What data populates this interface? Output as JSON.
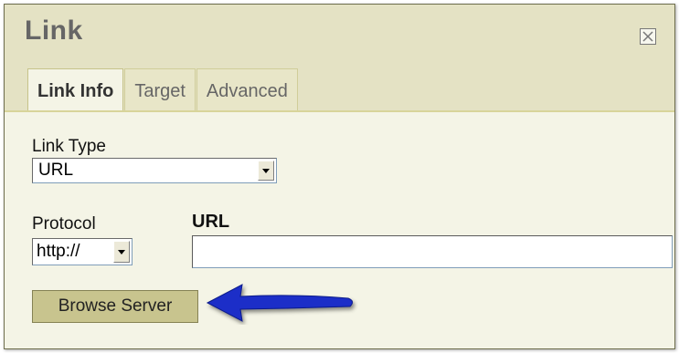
{
  "dialog": {
    "title": "Link",
    "close_icon": "close-icon"
  },
  "tabs": [
    {
      "label": "Link Info",
      "active": true
    },
    {
      "label": "Target",
      "active": false
    },
    {
      "label": "Advanced",
      "active": false
    }
  ],
  "form": {
    "link_type": {
      "label": "Link Type",
      "value": "URL"
    },
    "protocol": {
      "label": "Protocol",
      "value": "http://"
    },
    "url": {
      "label": "URL",
      "value": ""
    },
    "browse_button": "Browse Server"
  },
  "annotation": {
    "icon": "arrow-left-icon",
    "color": "#1a2fc8"
  },
  "colors": {
    "header_bg": "#e4e2c4",
    "body_bg": "#f4f4e6",
    "button_bg": "#c8c48e"
  }
}
